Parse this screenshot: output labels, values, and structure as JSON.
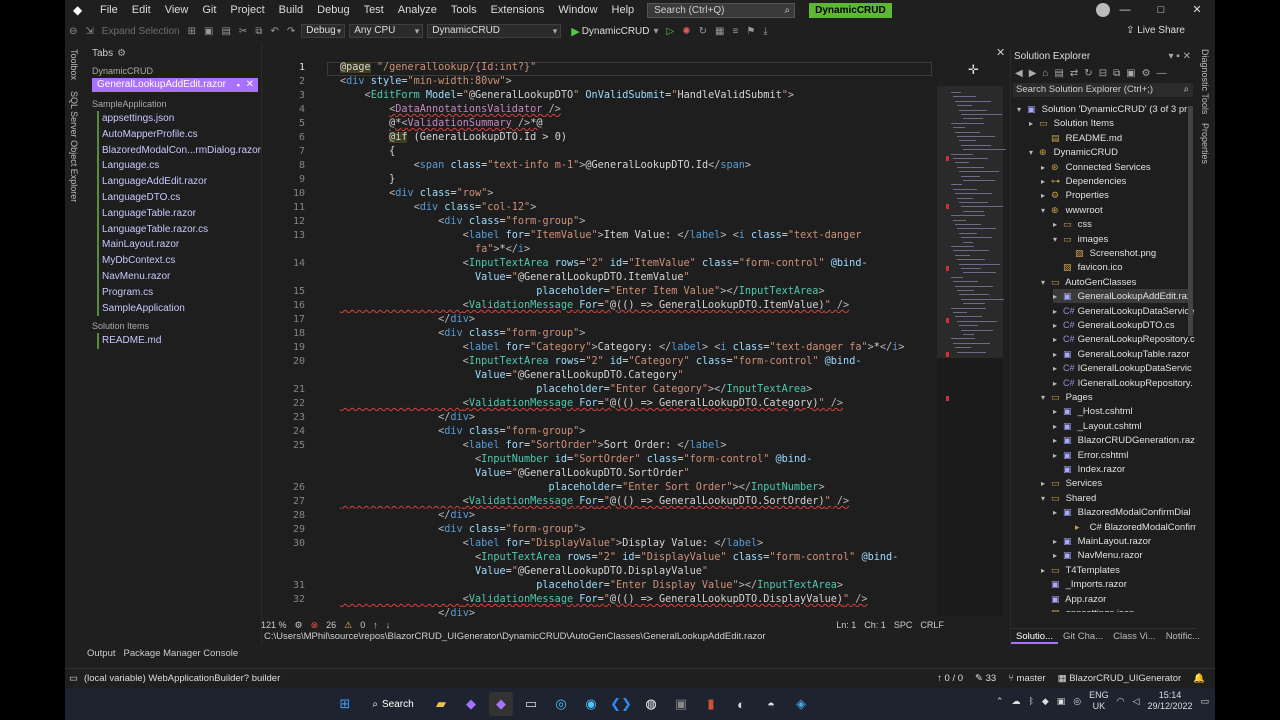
{
  "menu": {
    "items": [
      "File",
      "Edit",
      "View",
      "Git",
      "Project",
      "Build",
      "Debug",
      "Test",
      "Analyze",
      "Tools",
      "Extensions",
      "Window",
      "Help"
    ],
    "search": "Search (Ctrl+Q)",
    "solution": "DynamicCRUD"
  },
  "toolbar": {
    "expand_selection": "Expand Selection",
    "config": "Debug",
    "platform": "Any CPU",
    "project": "DynamicCRUD",
    "run": "DynamicCRUD",
    "live_share": "Live Share"
  },
  "left_strip": [
    "Toolbox",
    "SQL Server Object Explorer"
  ],
  "tabs_panel": {
    "title": "Tabs",
    "group1_label": "DynamicCRUD",
    "active_tab": "GeneralLookupAddEdit.razor",
    "group2_label": "SampleApplication",
    "items": [
      "appsettings.json",
      "AutoMapperProfile.cs",
      "BlazoredModalCon...rmDialog.razor.cs",
      "Language.cs",
      "LanguageAddEdit.razor",
      "LanguageDTO.cs",
      "LanguageTable.razor",
      "LanguageTable.razor.cs",
      "MainLayout.razor",
      "MyDbContext.cs",
      "NavMenu.razor",
      "Program.cs",
      "SampleApplication"
    ],
    "group3_label": "Solution Items",
    "group3_items": [
      "README.md"
    ]
  },
  "editor": {
    "line_numbers": [
      "1",
      "2",
      "3",
      "4",
      "5",
      "6",
      "7",
      "8",
      "9",
      "10",
      "11",
      "12",
      "13",
      "",
      "14",
      "",
      "15",
      "16",
      "17",
      "18",
      "19",
      "20",
      "",
      "21",
      "22",
      "23",
      "24",
      "25",
      "",
      "",
      "26",
      "27",
      "28",
      "29",
      "30",
      "",
      "",
      "31",
      "32"
    ],
    "zoom": "121 %",
    "errors": "26",
    "warnings": "0",
    "ln": "Ln: 1",
    "ch": "Ch: 1",
    "enc": "SPC",
    "eol": "CRLF",
    "path": "C:\\Users\\MPhil\\source\\repos\\BlazorCRUD_UIGenerator\\DynamicCRUD\\AutoGenClasses\\GeneralLookupAddEdit.razor"
  },
  "solution_explorer": {
    "title": "Solution Explorer",
    "search": "Search Solution Explorer (Ctrl+;)",
    "nodes": [
      {
        "label": "Solution 'DynamicCRUD' (3 of 3 pr",
        "indent": 0,
        "icon": "▣"
      },
      {
        "label": "Solution Items",
        "indent": 1,
        "icon": "▭"
      },
      {
        "label": "README.md",
        "indent": 2,
        "icon": "▤"
      },
      {
        "label": "DynamicCRUD",
        "indent": 1,
        "icon": "⊕"
      },
      {
        "label": "Connected Services",
        "indent": 2,
        "icon": "⊛"
      },
      {
        "label": "Dependencies",
        "indent": 2,
        "icon": "⊶"
      },
      {
        "label": "Properties",
        "indent": 2,
        "icon": "⚙"
      },
      {
        "label": "wwwroot",
        "indent": 2,
        "icon": "⊕"
      },
      {
        "label": "css",
        "indent": 3,
        "icon": "▭"
      },
      {
        "label": "images",
        "indent": 3,
        "icon": "▭"
      },
      {
        "label": "Screenshot.png",
        "indent": 4,
        "icon": "▨"
      },
      {
        "label": "favicon.ico",
        "indent": 3,
        "icon": "▨"
      },
      {
        "label": "AutoGenClasses",
        "indent": 2,
        "icon": "▭"
      },
      {
        "label": "GeneralLookupAddEdit.raz",
        "indent": 3,
        "icon": "▣"
      },
      {
        "label": "GeneralLookupDataService",
        "indent": 3,
        "icon": "C#"
      },
      {
        "label": "GeneralLookupDTO.cs",
        "indent": 3,
        "icon": "C#"
      },
      {
        "label": "GeneralLookupRepository.c",
        "indent": 3,
        "icon": "C#"
      },
      {
        "label": "GeneralLookupTable.razor",
        "indent": 3,
        "icon": "▣"
      },
      {
        "label": "IGeneralLookupDataServic",
        "indent": 3,
        "icon": "C#"
      },
      {
        "label": "IGeneralLookupRepository.",
        "indent": 3,
        "icon": "C#"
      },
      {
        "label": "Pages",
        "indent": 2,
        "icon": "▭"
      },
      {
        "label": "_Host.cshtml",
        "indent": 3,
        "icon": "▣"
      },
      {
        "label": "_Layout.cshtml",
        "indent": 3,
        "icon": "▣"
      },
      {
        "label": "BlazorCRUDGeneration.raz",
        "indent": 3,
        "icon": "▣"
      },
      {
        "label": "Error.cshtml",
        "indent": 3,
        "icon": "▣"
      },
      {
        "label": "Index.razor",
        "indent": 3,
        "icon": "▣"
      },
      {
        "label": "Services",
        "indent": 2,
        "icon": "▭"
      },
      {
        "label": "Shared",
        "indent": 2,
        "icon": "▭"
      },
      {
        "label": "BlazoredModalConfirmDial",
        "indent": 3,
        "icon": "▣"
      },
      {
        "label": "C# BlazoredModalConfirmD",
        "indent": 4,
        "icon": "▸"
      },
      {
        "label": "MainLayout.razor",
        "indent": 3,
        "icon": "▣"
      },
      {
        "label": "NavMenu.razor",
        "indent": 3,
        "icon": "▣"
      },
      {
        "label": "T4Templates",
        "indent": 2,
        "icon": "▭"
      },
      {
        "label": "_Imports.razor",
        "indent": 2,
        "icon": "▣"
      },
      {
        "label": "App.razor",
        "indent": 2,
        "icon": "▣"
      },
      {
        "label": "appsettings.json",
        "indent": 2,
        "icon": "▤"
      }
    ],
    "bottom_tabs": [
      "Solutio...",
      "Git Cha...",
      "Class Vi...",
      "Notific..."
    ]
  },
  "right_strip": [
    "Diagnostic Tools",
    "Properties"
  ],
  "output_tabs": [
    "Output",
    "Package Manager Console"
  ],
  "statusbar": {
    "message": "(local variable) WebApplicationBuilder? builder",
    "changes": "0 / 0",
    "pencil": "33",
    "branch": "master",
    "repo": "BlazorCRUD_UIGenerator"
  },
  "taskbar": {
    "search": "Search",
    "lang_top": "ENG",
    "lang_bottom": "UK",
    "time": "15:14",
    "date": "29/12/2022"
  }
}
